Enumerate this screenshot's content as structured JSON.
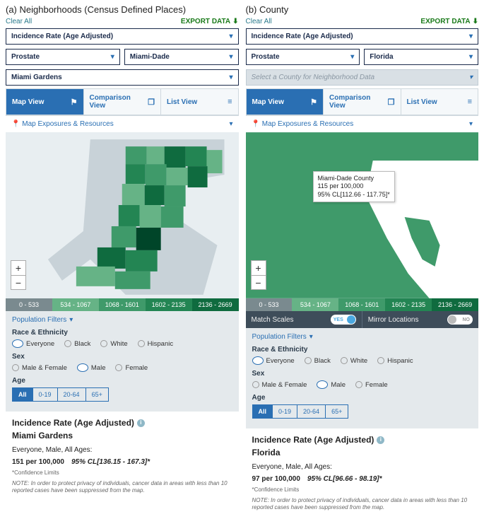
{
  "panels": {
    "a": {
      "title": "(a) Neighborhoods (Census Defined Places)",
      "clear": "Clear All",
      "export": "EXPORT DATA",
      "measure": "Incidence Rate (Age Adjusted)",
      "site": "Prostate",
      "region": "Miami-Dade",
      "sub": "Miami Gardens",
      "sub_disabled": false,
      "tabs": {
        "map": "Map View",
        "comp": "Comparison View",
        "list": "List View"
      },
      "exposures": "Map Exposures & Resources",
      "legend": [
        "0 - 533",
        "534 - 1067",
        "1068 - 1601",
        "1602 - 2135",
        "2136 - 2669"
      ],
      "filters_label": "Population Filters",
      "race_title": "Race & Ethnicity",
      "race_opts": [
        "Everyone",
        "Black",
        "White",
        "Hispanic"
      ],
      "race_sel": 0,
      "sex_title": "Sex",
      "sex_opts": [
        "Male & Female",
        "Male",
        "Female"
      ],
      "sex_sel": 1,
      "age_title": "Age",
      "age_opts": [
        "All",
        "0-19",
        "20-64",
        "65+"
      ],
      "age_sel": 0,
      "summary_title": "Incidence Rate (Age Adjusted)",
      "summary_place": "Miami Gardens",
      "summary_group": "Everyone, Male, All Ages:",
      "summary_rate": "151 per 100,000",
      "summary_cl": "95% CL[136.15 - 167.3]*",
      "cl_note": "*Confidence Limits",
      "note": "NOTE: In order to protect privacy of individuals, cancer data in areas with less than 10 reported cases have been suppressed from the map."
    },
    "b": {
      "title": "(b) County",
      "clear": "Clear All",
      "export": "EXPORT DATA",
      "measure": "Incidence Rate (Age Adjusted)",
      "site": "Prostate",
      "region": "Florida",
      "sub": "Select a County for Neighborhood Data",
      "sub_disabled": true,
      "tabs": {
        "map": "Map View",
        "comp": "Comparison View",
        "list": "List View"
      },
      "exposures": "Map Exposures & Resources",
      "tooltip": {
        "name": "Miami-Dade County",
        "rate": "115 per 100,000",
        "cl": "95% CL[112.66 - 117.75]*"
      },
      "legend": [
        "0 - 533",
        "534 - 1067",
        "1068 - 1601",
        "1602 - 2135",
        "2136 - 2669"
      ],
      "match_scales": "Match Scales",
      "mirror": "Mirror Locations",
      "yes": "YES",
      "no": "NO",
      "filters_label": "Population Filters",
      "race_title": "Race & Ethnicity",
      "race_opts": [
        "Everyone",
        "Black",
        "White",
        "Hispanic"
      ],
      "race_sel": 0,
      "sex_title": "Sex",
      "sex_opts": [
        "Male & Female",
        "Male",
        "Female"
      ],
      "sex_sel": 1,
      "age_title": "Age",
      "age_opts": [
        "All",
        "0-19",
        "20-64",
        "65+"
      ],
      "age_sel": 0,
      "summary_title": "Incidence Rate (Age Adjusted)",
      "summary_place": "Florida",
      "summary_group": "Everyone, Male, All Ages:",
      "summary_rate": "97 per 100,000",
      "summary_cl": "95% CL[96.66 - 98.19]*",
      "cl_note": "*Confidence Limits",
      "note": "NOTE: In order to protect privacy of individuals, cancer data in areas with less than 10 reported cases have been suppressed from the map."
    }
  },
  "chart_data": [
    {
      "type": "area",
      "title": "Miami-Dade neighborhoods choropleth",
      "variable": "Incidence Rate (Age Adjusted) – Prostate",
      "breaks": [
        0,
        533,
        1067,
        1601,
        2135,
        2669
      ],
      "colors": [
        "#7a8a8f",
        "#66b386",
        "#3f9a6a",
        "#238553",
        "#0f6b3f",
        "#004529"
      ]
    },
    {
      "type": "area",
      "title": "Florida counties choropleth",
      "variable": "Incidence Rate (Age Adjusted) – Prostate",
      "breaks": [
        0,
        533,
        1067,
        1601,
        2135,
        2669
      ],
      "highlight": {
        "region": "Miami-Dade County",
        "value": 115,
        "cl_low": 112.66,
        "cl_high": 117.75
      }
    }
  ],
  "legend_colors": [
    "#7a8a8f",
    "#66b386",
    "#3f9a6a",
    "#238553",
    "#0f6b3f"
  ]
}
